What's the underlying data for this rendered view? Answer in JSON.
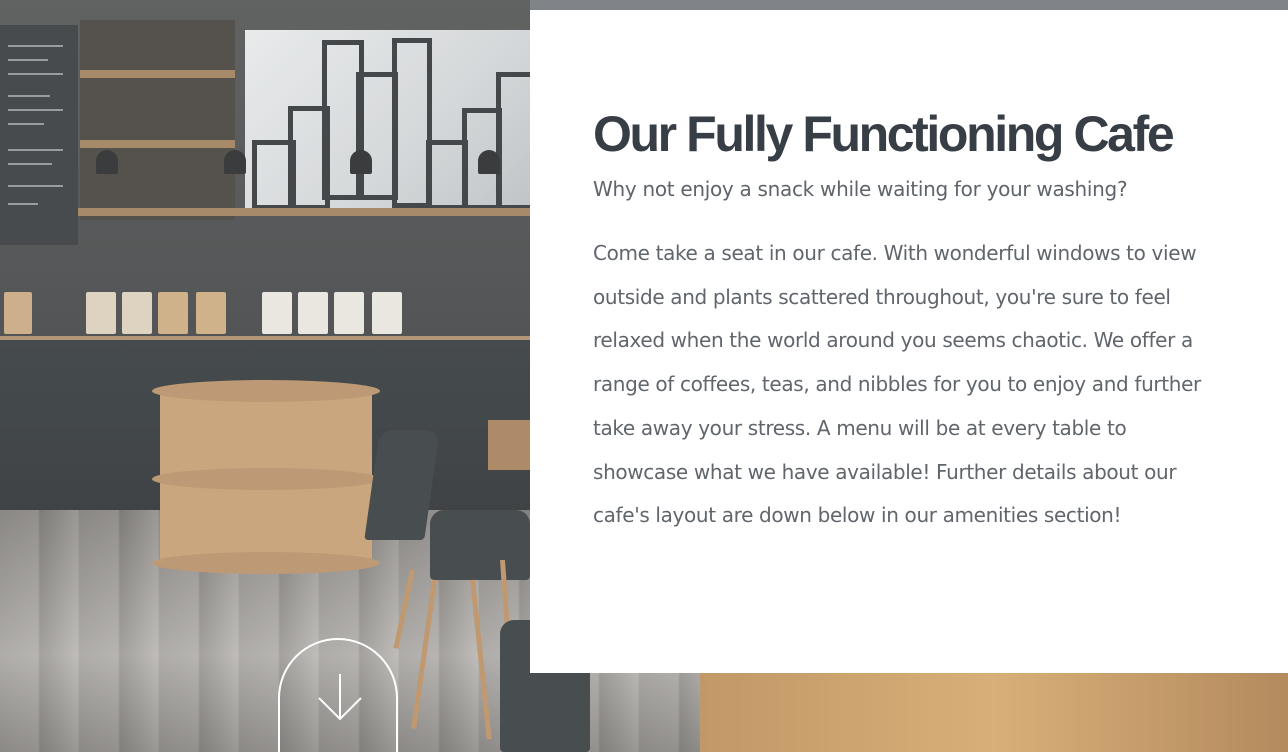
{
  "cafe": {
    "title": "Our Fully Functioning Cafe",
    "subtitle": "Why not enjoy a snack while waiting for your washing?",
    "body": "Come take a seat in our cafe. With wonderful windows to view outside and plants scattered throughout, you're sure to feel relaxed when the world around you seems chaotic. We offer a range of coffees, teas, and nibbles for you to enjoy and further take away your stress. A menu will be at every table to showcase what we have available! Further details about our cafe's layout are down below in our amenities section!"
  },
  "scroll": {
    "icon": "arrow-down-icon"
  },
  "colors": {
    "heading": "#373e46",
    "text": "#60666c",
    "card_bg": "#ffffff",
    "button_outline": "#ffffff"
  }
}
